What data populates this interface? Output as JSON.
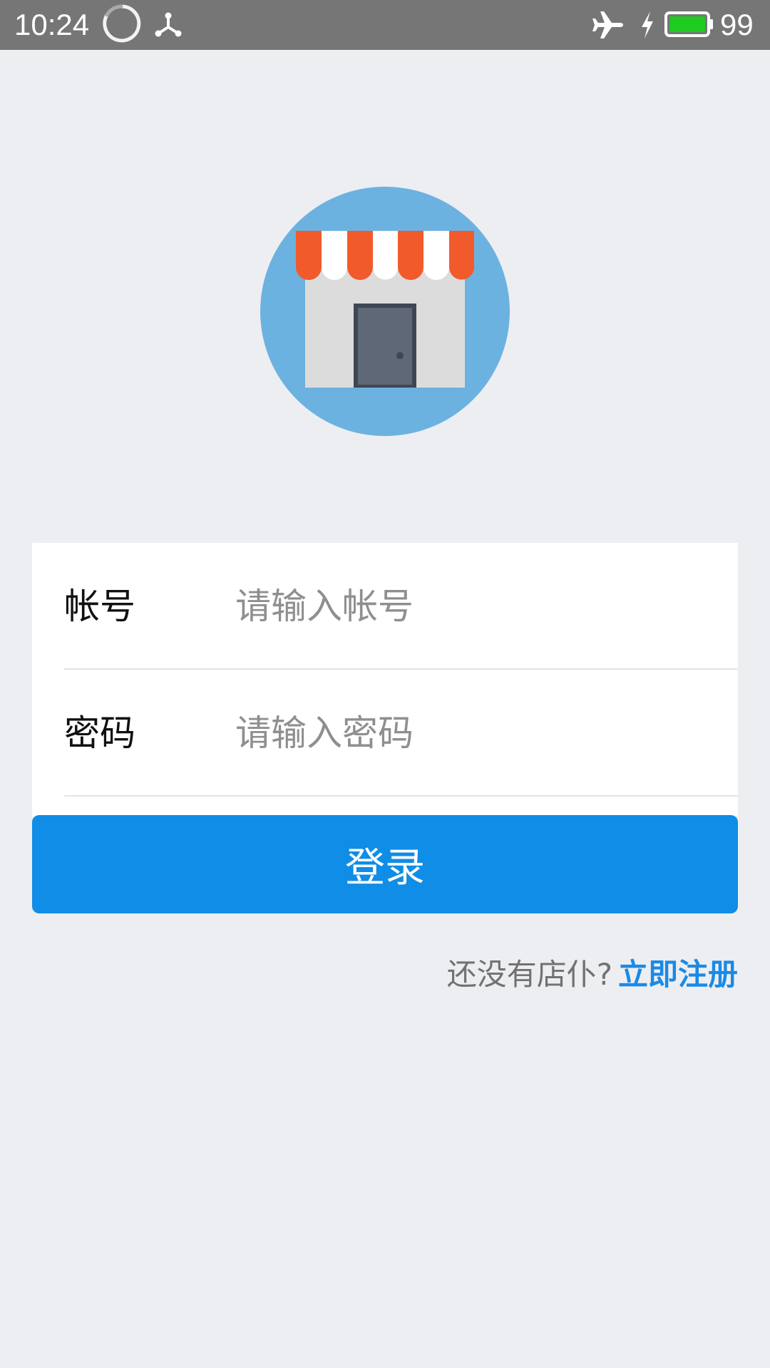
{
  "status_bar": {
    "time": "10:24",
    "battery_level": "99",
    "icons": [
      "loading-spinner-icon",
      "usb-icon",
      "airplane-icon",
      "charging-icon",
      "battery-icon"
    ],
    "battery_color": "#1fcb1f"
  },
  "logo": {
    "icon": "storefront-icon",
    "circle_color": "#6cb2e0",
    "awning_colors": [
      "#f15a2b",
      "#ffffff"
    ]
  },
  "form": {
    "account_label": "帐号",
    "account_placeholder": "请输入帐号",
    "account_value": "",
    "password_label": "密码",
    "password_placeholder": "请输入密码",
    "password_value": ""
  },
  "login_button": {
    "label": "登录",
    "color": "#108de6"
  },
  "register": {
    "prompt": "还没有店仆?",
    "link": "立即注册",
    "link_color": "#1a8ae6"
  }
}
